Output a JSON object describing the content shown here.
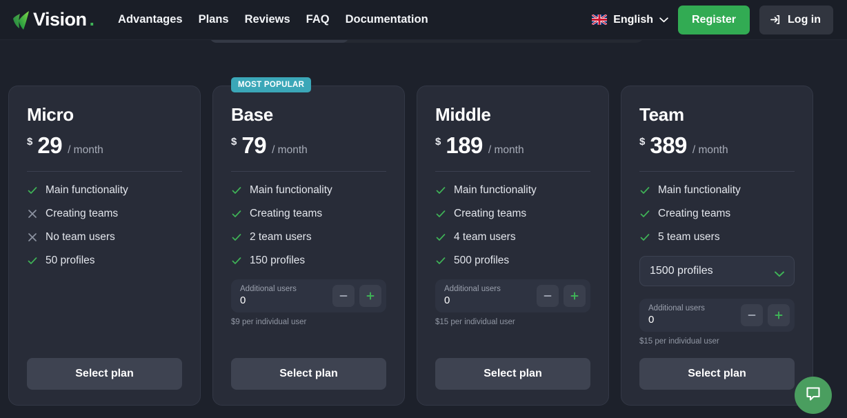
{
  "header": {
    "logo_text": "Vision",
    "logo_dot": ".",
    "logo_icon": "leaf-icon",
    "nav": [
      {
        "label": "Advantages"
      },
      {
        "label": "Plans"
      },
      {
        "label": "Reviews"
      },
      {
        "label": "FAQ"
      },
      {
        "label": "Documentation"
      }
    ],
    "language": {
      "label": "English",
      "flag_icon": "uk-flag-icon",
      "chevron_icon": "chevron-down-icon"
    },
    "register_label": "Register",
    "login_label": "Log in",
    "login_icon": "login-arrow-icon",
    "register_color": "#32ab53"
  },
  "badge_color": "#3ba7b8",
  "plans": [
    {
      "name": "Micro",
      "badge": "",
      "currency": "$",
      "amount": "29",
      "period": "/ month",
      "features": [
        {
          "icon": "check-icon",
          "label": "Main functionality",
          "included": true
        },
        {
          "icon": "cross-icon",
          "label": "Creating teams",
          "included": false
        },
        {
          "icon": "cross-icon",
          "label": "No team users",
          "included": false
        },
        {
          "icon": "check-icon",
          "label": "50 profiles",
          "included": true
        }
      ],
      "dropdown": null,
      "stepper": null,
      "hint": "",
      "cta": "Select plan"
    },
    {
      "name": "Base",
      "badge": "MOST POPULAR",
      "currency": "$",
      "amount": "79",
      "period": "/ month",
      "features": [
        {
          "icon": "check-icon",
          "label": "Main functionality",
          "included": true
        },
        {
          "icon": "check-icon",
          "label": "Creating teams",
          "included": true
        },
        {
          "icon": "check-icon",
          "label": "2 team users",
          "included": true
        },
        {
          "icon": "check-icon",
          "label": "150 profiles",
          "included": true
        }
      ],
      "dropdown": null,
      "stepper": {
        "label": "Additional users",
        "value": "0",
        "minus_icon": "minus-icon",
        "plus_icon": "plus-icon"
      },
      "hint": "$9 per individual user",
      "cta": "Select plan"
    },
    {
      "name": "Middle",
      "badge": "",
      "currency": "$",
      "amount": "189",
      "period": "/ month",
      "features": [
        {
          "icon": "check-icon",
          "label": "Main functionality",
          "included": true
        },
        {
          "icon": "check-icon",
          "label": "Creating teams",
          "included": true
        },
        {
          "icon": "check-icon",
          "label": "4 team users",
          "included": true
        },
        {
          "icon": "check-icon",
          "label": "500 profiles",
          "included": true
        }
      ],
      "dropdown": null,
      "stepper": {
        "label": "Additional users",
        "value": "0",
        "minus_icon": "minus-icon",
        "plus_icon": "plus-icon"
      },
      "hint": "$15 per individual user",
      "cta": "Select plan"
    },
    {
      "name": "Team",
      "badge": "",
      "currency": "$",
      "amount": "389",
      "period": "/ month",
      "features": [
        {
          "icon": "check-icon",
          "label": "Main functionality",
          "included": true
        },
        {
          "icon": "check-icon",
          "label": "Creating teams",
          "included": true
        },
        {
          "icon": "check-icon",
          "label": "5 team users",
          "included": true
        }
      ],
      "dropdown": {
        "value": "1500 profiles",
        "chevron_icon": "chevron-down-icon"
      },
      "stepper": {
        "label": "Additional users",
        "value": "0",
        "minus_icon": "minus-icon",
        "plus_icon": "plus-icon"
      },
      "hint": "$15 per individual user",
      "cta": "Select plan"
    }
  ],
  "chat": {
    "icon": "chat-bubble-icon",
    "color": "#4a9e5f"
  }
}
